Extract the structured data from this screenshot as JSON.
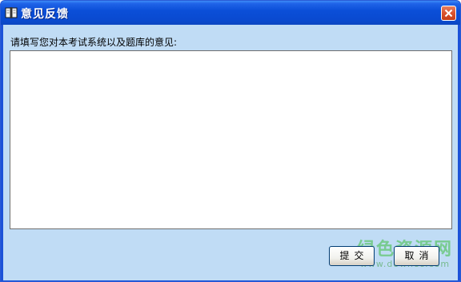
{
  "window": {
    "title": "意见反馈",
    "title_icon": "book-icon",
    "close_icon": "close-icon",
    "accent_color": "#0a4ad0",
    "client_color": "#c0dcf5"
  },
  "form": {
    "prompt": "请填写您对本考试系统以及题库的意见:",
    "feedback_value": ""
  },
  "buttons": {
    "submit_label": "提交",
    "cancel_label": "取消"
  },
  "watermark": {
    "main": "绿色资源网",
    "sub": "www.downcc.com"
  }
}
